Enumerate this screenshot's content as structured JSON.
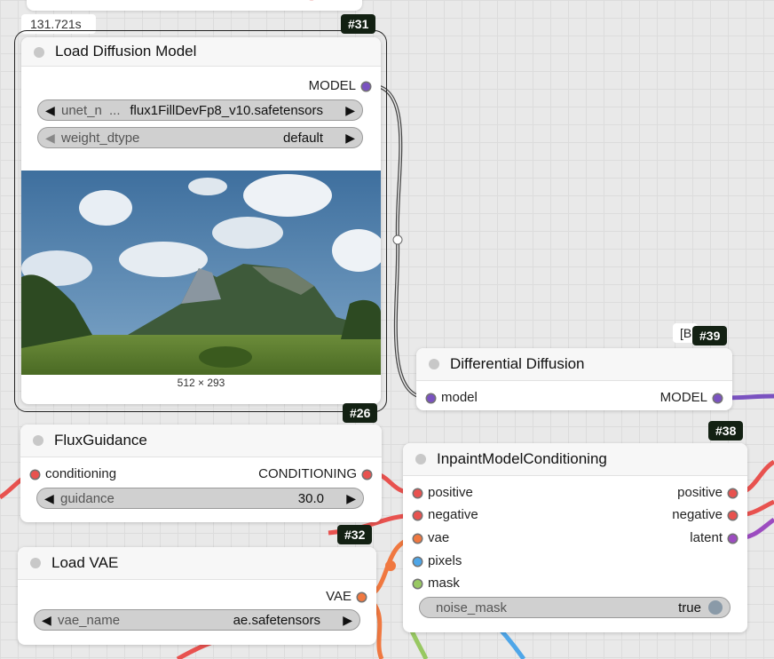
{
  "timer": "131.721s",
  "colors": {
    "model": "#7a52c0",
    "conditioning": "#e8524f",
    "vae": "#f07840",
    "image": "#4ea6e8",
    "mask": "#98c862",
    "latent": "#9c4cc0",
    "badge_bg": "#132113"
  },
  "toolbar": {
    "icons": [
      "play-icon",
      "circle-icon",
      "pin-icon",
      "bypass-icon",
      "copy-icon",
      "edit-icon",
      "collapse-icon",
      "delete-icon",
      "info-icon"
    ]
  },
  "nodes": {
    "load_diffusion_model": {
      "id": "#31",
      "title": "Load Diffusion Model",
      "outputs": [
        "MODEL"
      ],
      "widgets": [
        {
          "label": "unet_n",
          "ellipsis": "...",
          "value": "flux1FillDevFp8_v10.safetensors"
        },
        {
          "label": "weight_dtype",
          "value": "default"
        }
      ],
      "preview_caption": "512 × 293"
    },
    "flux_guidance": {
      "id": "#26",
      "title": "FluxGuidance",
      "inputs": [
        "conditioning"
      ],
      "outputs": [
        "CONDITIONING"
      ],
      "widgets": [
        {
          "label": "guidance",
          "value": "30.0"
        }
      ]
    },
    "load_vae": {
      "id": "#32",
      "title": "Load VAE",
      "outputs": [
        "VAE"
      ],
      "widgets": [
        {
          "label": "vae_name",
          "value": "ae.safetensors"
        }
      ]
    },
    "differential_diffusion": {
      "id": "#39",
      "partial_badge": "[B",
      "title": "Differential Diffusion",
      "inputs": [
        "model"
      ],
      "outputs": [
        "MODEL"
      ]
    },
    "inpaint_model_conditioning": {
      "id": "#38",
      "title": "InpaintModelConditioning",
      "inputs": [
        "positive",
        "negative",
        "vae",
        "pixels",
        "mask"
      ],
      "outputs": [
        "positive",
        "negative",
        "latent"
      ],
      "widgets": [
        {
          "label": "noise_mask",
          "value": "true"
        }
      ]
    }
  }
}
